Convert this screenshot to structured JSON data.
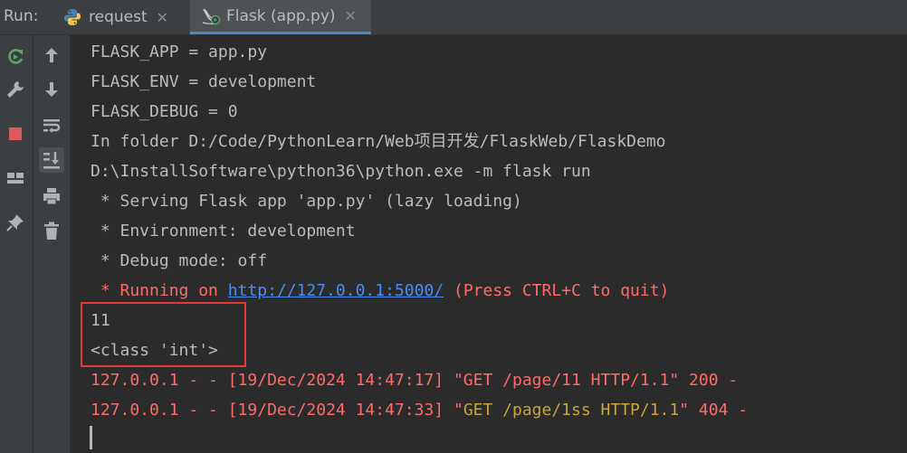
{
  "run_label": "Run:",
  "tabs": [
    {
      "label": "request",
      "icon": "python-icon",
      "active": false
    },
    {
      "label": "Flask (app.py)",
      "icon": "flask-icon",
      "active": true
    }
  ],
  "close_glyph": "✕",
  "toolbar1": [
    {
      "name": "rerun-icon",
      "color": "#59a869"
    },
    {
      "name": "wrench-icon"
    },
    {
      "name": "stop-icon",
      "color": "#db5c5c"
    },
    {
      "name": "layout-icon"
    },
    {
      "name": "pin-icon"
    }
  ],
  "toolbar2": [
    {
      "name": "arrow-up-icon"
    },
    {
      "name": "arrow-down-icon"
    },
    {
      "name": "soft-wrap-icon"
    },
    {
      "name": "scroll-to-end-icon",
      "active": true
    },
    {
      "name": "print-icon"
    },
    {
      "name": "trash-icon"
    }
  ],
  "console": {
    "line1": "FLASK_APP = app.py",
    "line2": "FLASK_ENV = development",
    "line3": "FLASK_DEBUG = 0",
    "line4": "In folder D:/Code/PythonLearn/Web项目开发/FlaskWeb/FlaskDemo",
    "line5": "D:\\InstallSoftware\\python36\\python.exe -m flask run",
    "line6": " * Serving Flask app 'app.py' (lazy loading)",
    "line7": " * Environment: development",
    "line8": " * Debug mode: off",
    "line9_prefix": " * Running on ",
    "line9_link": "http://127.0.0.1:5000/",
    "line9_suffix": " (Press CTRL+C to quit)",
    "line10": "11",
    "line11": "<class 'int'>",
    "line12": "127.0.0.1 - - [19/Dec/2024 14:47:17] \"GET /page/11 HTTP/1.1\" 200 -",
    "line13_prefix": "127.0.0.1 - - [19/Dec/2024 14:47:33] \"",
    "line13_orange": "GET /page/1ss HTTP/1.1",
    "line13_suffix": "\" 404 -"
  },
  "colors": {
    "background": "#2b2b2b",
    "error_red": "#ff6b68",
    "link_blue": "#4c8cf5",
    "warn_orange": "#c9a33b",
    "annotation_red": "#e53935"
  }
}
